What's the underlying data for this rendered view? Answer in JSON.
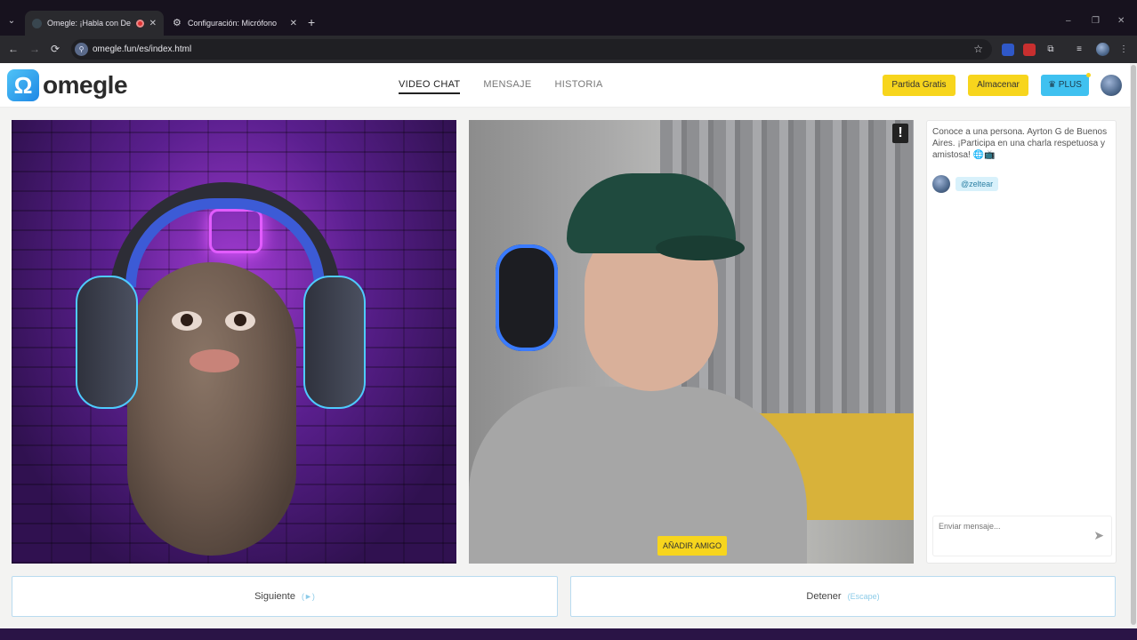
{
  "browser": {
    "tabs": [
      {
        "title": "Omegle: ¡Habla con Descon",
        "active": true,
        "recording": true
      },
      {
        "title": "Configuración: Micrófono",
        "active": false
      }
    ],
    "new_tab_symbol": "+",
    "url": "omegle.fun/es/index.html",
    "window_controls": [
      "–",
      "❐",
      "✕"
    ],
    "nav_symbols": {
      "back": "←",
      "forward": "→",
      "reload": "⟳"
    },
    "star_symbol": "☆"
  },
  "header": {
    "logo_mark": "Ω",
    "logo_text": "omegle",
    "nav": [
      {
        "label": "VIDEO CHAT",
        "active": true
      },
      {
        "label": "MENSAJE",
        "active": false
      },
      {
        "label": "HISTORIA",
        "active": false
      }
    ],
    "buttons": {
      "free_match": "Partida Gratis",
      "store": "Almacenar",
      "plus": "♛ PLUS"
    }
  },
  "videos": {
    "report_symbol": "!",
    "add_friend": "AÑADIR AMIGO"
  },
  "chat": {
    "intro": "Conoce a una persona. Ayrton G de Buenos Aires. ¡Participa en una charla respetuosa y amistosa! 🌐📺",
    "user_handle": "@zeltear",
    "input_placeholder": "Enviar mensaje...",
    "send_icon": "➤"
  },
  "controls": {
    "next": {
      "label": "Siguiente",
      "hint": "(►)"
    },
    "stop": {
      "label": "Detener",
      "hint": "(Escape)"
    }
  },
  "colors": {
    "accent_yellow": "#f7d51d",
    "accent_blue": "#3fc1f0",
    "browser_dark": "#2a2a2e"
  }
}
